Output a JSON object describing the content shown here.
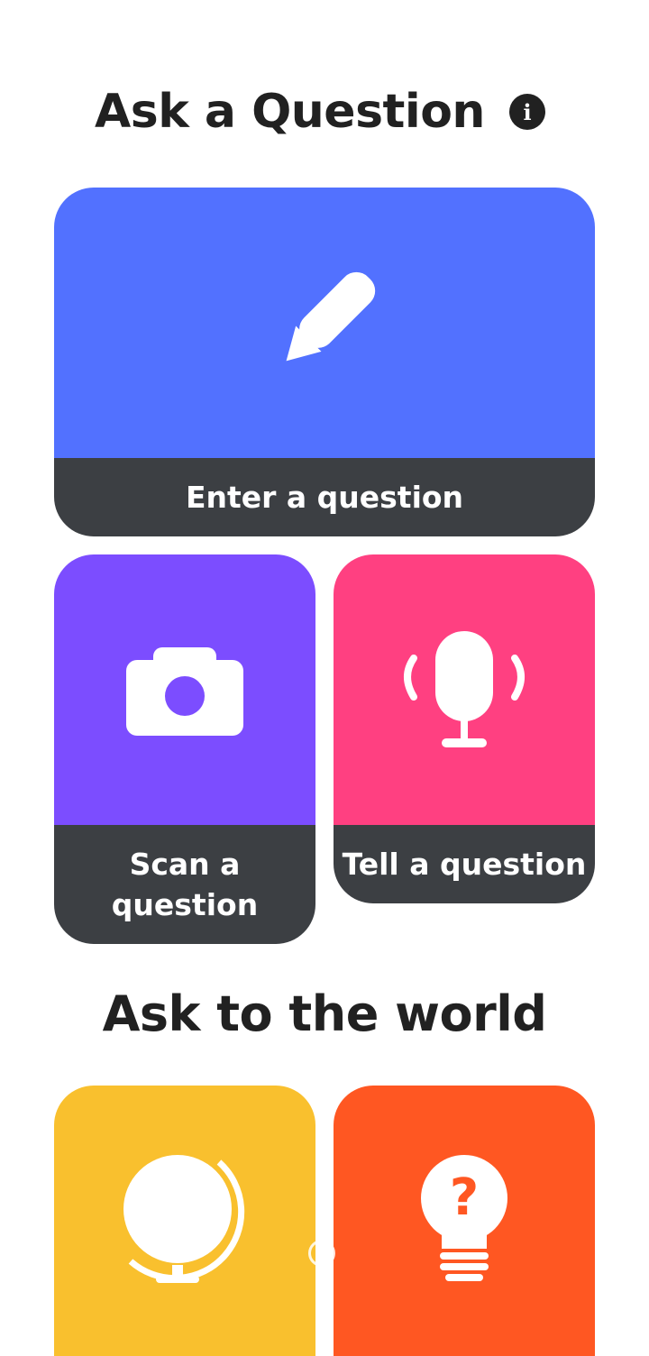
{
  "header": {
    "title": "Ask a Question",
    "info_icon": "info-icon"
  },
  "cards": {
    "enter": {
      "label": "Enter a question",
      "color": "#5271ff",
      "icon": "pencil-icon"
    },
    "scan": {
      "label": "Scan a question",
      "color": "#7c4dff",
      "icon": "camera-icon"
    },
    "tell": {
      "label": "Tell a question",
      "color": "#ff4081",
      "icon": "microphone-icon"
    }
  },
  "section": {
    "title": "Ask to the world"
  },
  "world_cards": {
    "globe": {
      "color": "#f9c02e",
      "icon": "globe-icon"
    },
    "idea": {
      "color": "#ff5722",
      "icon": "lightbulb-question-icon"
    }
  },
  "bottom_label_color": "#3c3f43"
}
